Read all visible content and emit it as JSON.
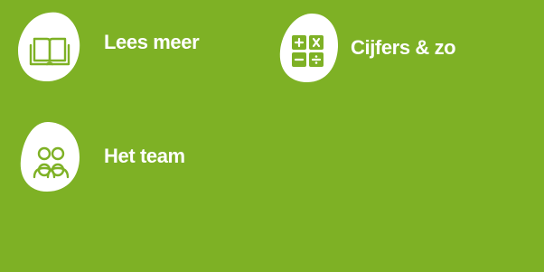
{
  "colors": {
    "background": "#7eb125",
    "blob": "#ffffff",
    "icon": "#7eb125",
    "text": "#ffffff"
  },
  "links": [
    {
      "label": "Lees meer",
      "icon": "book-icon"
    },
    {
      "label": "Cijfers & zo",
      "icon": "calculator-icon"
    },
    {
      "label": "Het team",
      "icon": "team-icon"
    }
  ]
}
